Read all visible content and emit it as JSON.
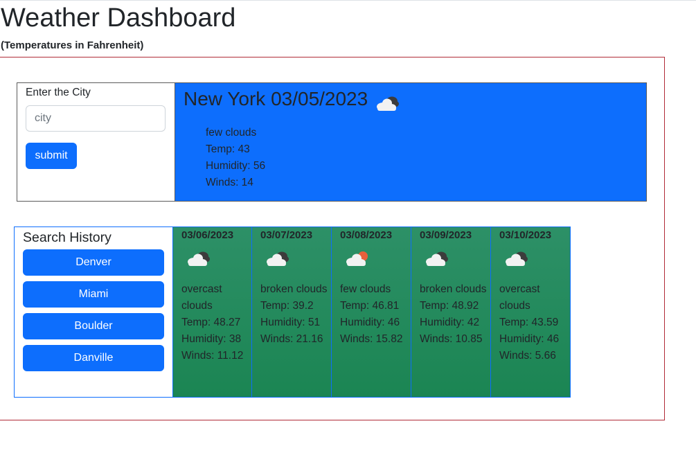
{
  "header": {
    "title": "Weather Dashboard",
    "subtitle": "(Temperatures in Fahrenheit)"
  },
  "search": {
    "label": "Enter the City",
    "placeholder": "city",
    "value": "",
    "submit_label": "submit"
  },
  "current": {
    "title": "New York 03/05/2023",
    "icon": "few-clouds-night-icon",
    "description": "few clouds",
    "temp": "Temp: 43",
    "humidity": "Humidity: 56",
    "winds": "Winds: 14",
    "background_color": "#0d6efd"
  },
  "history": {
    "title": "Search History",
    "items": [
      {
        "label": "Denver"
      },
      {
        "label": "Miami"
      },
      {
        "label": "Boulder"
      },
      {
        "label": "Danville"
      }
    ]
  },
  "forecast": [
    {
      "date": "03/06/2023",
      "icon": "clouds-icon",
      "description": "overcast clouds",
      "temp": "Temp: 48.27",
      "humidity": "Humidity: 38",
      "winds": "Winds: 11.12"
    },
    {
      "date": "03/07/2023",
      "icon": "clouds-icon",
      "description": "broken clouds",
      "temp": "Temp: 39.2",
      "humidity": "Humidity: 51",
      "winds": "Winds: 21.16"
    },
    {
      "date": "03/08/2023",
      "icon": "few-clouds-sun-icon",
      "description": "few clouds",
      "temp": "Temp: 46.81",
      "humidity": "Humidity: 46",
      "winds": "Winds: 15.82"
    },
    {
      "date": "03/09/2023",
      "icon": "clouds-icon",
      "description": "broken clouds",
      "temp": "Temp: 48.92",
      "humidity": "Humidity: 42",
      "winds": "Winds: 10.85"
    },
    {
      "date": "03/10/2023",
      "icon": "clouds-icon",
      "description": "overcast clouds",
      "temp": "Temp: 43.59",
      "humidity": "Humidity: 46",
      "winds": "Winds: 5.66"
    }
  ],
  "colors": {
    "primary": "#0d6efd",
    "forecast_card": "#1b8553",
    "frame_border": "#b02a37"
  }
}
